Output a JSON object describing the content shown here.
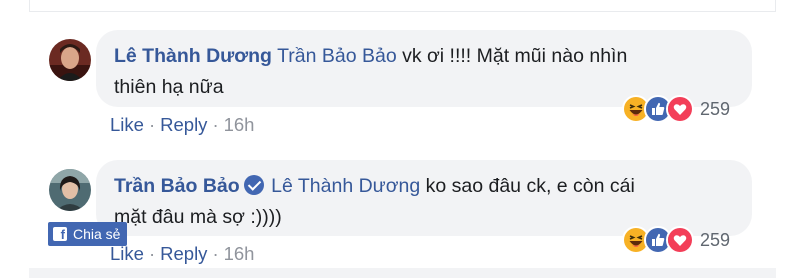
{
  "comments": [
    {
      "author": "Lê Thành Dương",
      "mention": "Trần Bảo Bảo",
      "text_line1": " vk ơi !!!! Mặt mũi nào nhìn",
      "text_line2": "thiên hạ nữa",
      "verified": false,
      "reactions": [
        "haha-icon",
        "like-icon",
        "love-icon"
      ],
      "reaction_count": "259",
      "like_label": "Like",
      "reply_label": "Reply",
      "time": "16h"
    },
    {
      "author": "Trần Bảo Bảo",
      "mention": "Lê Thành Dương",
      "text_line1": " ko sao đâu ck, e còn cái",
      "text_line2": "mặt đâu mà sợ :))))",
      "verified": true,
      "reactions": [
        "haha-icon",
        "like-icon",
        "love-icon"
      ],
      "reaction_count": "259",
      "like_label": "Like",
      "reply_label": "Reply",
      "time": "16h"
    }
  ],
  "share_button": {
    "label": "Chia sẻ",
    "icon": "facebook-icon"
  },
  "colors": {
    "link": "#365899",
    "bubble": "#f2f3f5",
    "meta": "#90949c",
    "share_bg": "#4267b2",
    "love": "#f33e58",
    "like": "#4267b2",
    "haha": "#f7b125"
  }
}
